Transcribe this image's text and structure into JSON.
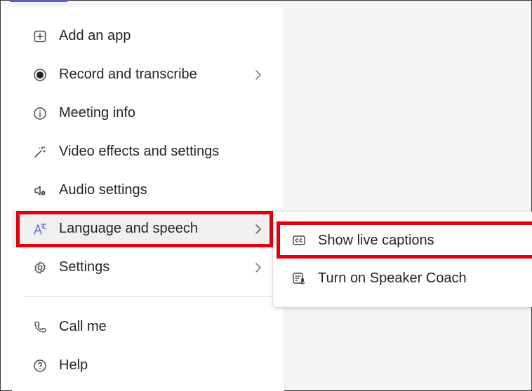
{
  "accent_color": "#5b5fc7",
  "highlight_color": "#e2000f",
  "menu": {
    "items": [
      {
        "label": "Add an app",
        "icon": "add-square-icon",
        "has_submenu": false
      },
      {
        "label": "Record and transcribe",
        "icon": "record-icon",
        "has_submenu": true
      },
      {
        "label": "Meeting info",
        "icon": "info-icon",
        "has_submenu": false
      },
      {
        "label": "Video effects and settings",
        "icon": "magic-wand-icon",
        "has_submenu": false
      },
      {
        "label": "Audio settings",
        "icon": "speaker-settings-icon",
        "has_submenu": false
      },
      {
        "label": "Language and speech",
        "icon": "translate-icon",
        "has_submenu": true
      },
      {
        "label": "Settings",
        "icon": "gear-icon",
        "has_submenu": true
      },
      {
        "label": "Call me",
        "icon": "phone-icon",
        "has_submenu": false
      },
      {
        "label": "Help",
        "icon": "help-icon",
        "has_submenu": false
      }
    ]
  },
  "submenu": {
    "items": [
      {
        "label": "Show live captions",
        "icon": "closed-captions-icon"
      },
      {
        "label": "Turn on Speaker Coach",
        "icon": "speaker-coach-icon"
      }
    ]
  }
}
